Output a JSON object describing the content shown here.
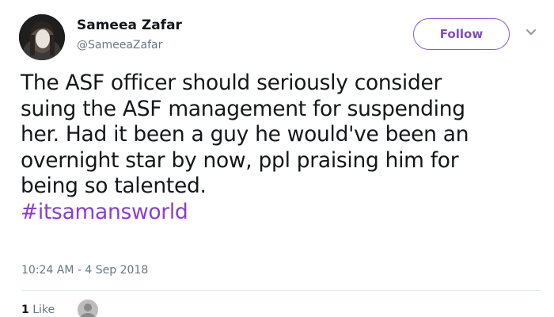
{
  "author": {
    "name": "Sameea Zafar",
    "handle": "@SameeaZafar",
    "avatar_icon": "profile-photo-avatar"
  },
  "follow_button": {
    "label": "Follow",
    "color": "#8b59c8"
  },
  "tweet": {
    "text_lines": [
      "The ASF officer should seriously consider",
      "suing the ASF management for suspending",
      "her. Had it been a guy he would've been an",
      "overnight star by now, ppl praising him for",
      "being so talented."
    ],
    "hashtag": "#itsamansworld",
    "hashtag_color": "#8b3dd1"
  },
  "timestamp": "10:24 AM - 4 Sep 2018",
  "likes": {
    "count": "1",
    "label": "Like"
  }
}
